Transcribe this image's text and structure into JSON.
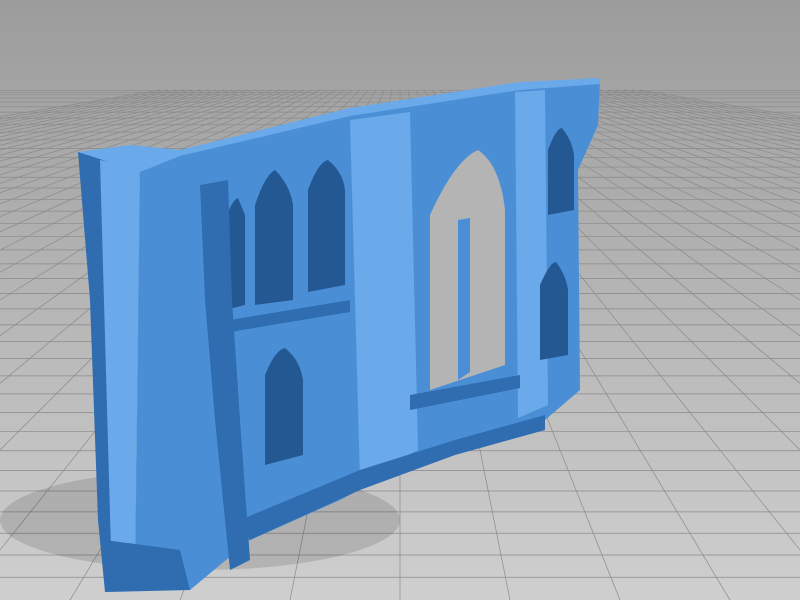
{
  "scene": {
    "colors": {
      "background_top": "#9c9c9c",
      "background_bottom": "#cfcfcf",
      "grid_line": "#8a8a8a",
      "model_main": "#4a8fd6",
      "model_light": "#6aa9ea",
      "model_shadow": "#2f6cb0",
      "model_dark": "#245893"
    }
  }
}
